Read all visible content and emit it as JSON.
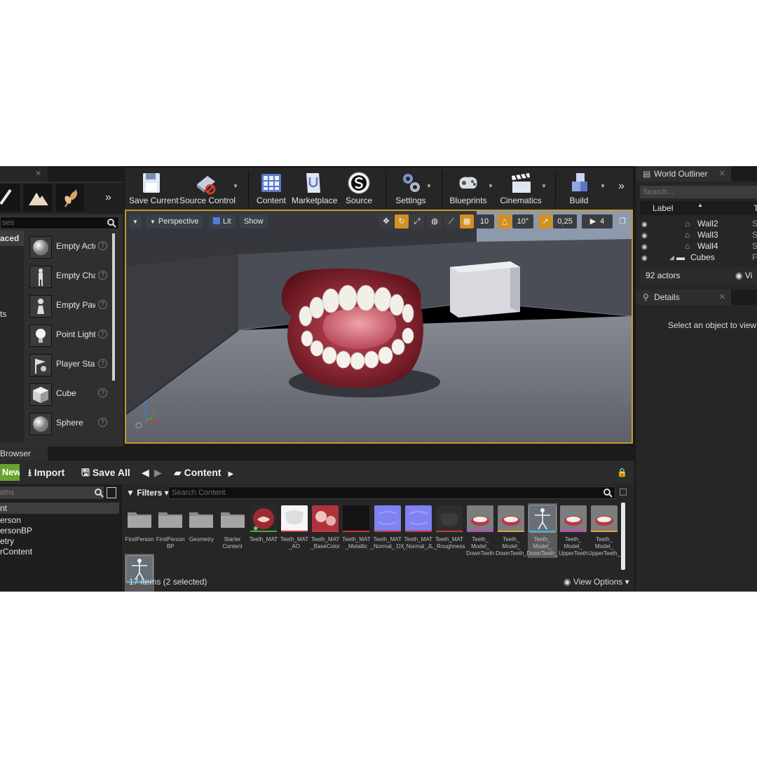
{
  "modes_panel": {
    "search_placeholder": "ses",
    "categories": [
      {
        "label": "aced",
        "selected": true
      },
      {
        "label": "ts",
        "selected": false
      }
    ],
    "place_items": [
      {
        "name": "Empty Actor",
        "icon": "sphere-icon"
      },
      {
        "name": "Empty Character",
        "icon": "mannequin-icon"
      },
      {
        "name": "Empty Pawn",
        "icon": "pawn-icon"
      },
      {
        "name": "Point Light",
        "icon": "lightbulb-icon"
      },
      {
        "name": "Player Start",
        "icon": "flag-icon"
      },
      {
        "name": "Cube",
        "icon": "cube-icon"
      },
      {
        "name": "Sphere",
        "icon": "sphere-icon"
      }
    ],
    "help_glyph": "?"
  },
  "toolbar": {
    "buttons": [
      {
        "label": "Save Current",
        "icon": "save-icon"
      },
      {
        "label": "Source Control",
        "icon": "source-control-icon"
      },
      {
        "label": "Content",
        "icon": "content-grid-icon"
      },
      {
        "label": "Marketplace",
        "icon": "marketplace-icon"
      },
      {
        "label": "Source",
        "icon": "source-icon"
      },
      {
        "label": "Settings",
        "icon": "settings-icon"
      },
      {
        "label": "Blueprints",
        "icon": "blueprints-icon"
      },
      {
        "label": "Cinematics",
        "icon": "clapper-icon"
      },
      {
        "label": "Build",
        "icon": "build-icon"
      }
    ]
  },
  "viewport": {
    "perspective_label": "Perspective",
    "lit_label": "Lit",
    "show_label": "Show",
    "grid_snap": "10",
    "rotation_snap": "10°",
    "scale_snap": "0,25",
    "camera_speed": "4",
    "accent_color": "#d28f24",
    "border_color": "#c49a2a"
  },
  "content_browser": {
    "tab_label": "Browser",
    "add_new_label": "Add New",
    "import_label": "Import",
    "save_all_label": "Save All",
    "path_label": "Content",
    "paths_placeholder": "Paths",
    "filters_label": "Filters",
    "search_placeholder": "Search Content",
    "folders": [
      {
        "label": "nt",
        "selected": true
      },
      {
        "label": "erson",
        "selected": false
      },
      {
        "label": "ersonBP",
        "selected": false
      },
      {
        "label": "etry",
        "selected": false
      },
      {
        "label": "rContent",
        "selected": false
      }
    ],
    "assets": [
      {
        "label": "FirstPerson",
        "kind": "folder"
      },
      {
        "label": "FirstPerson BP",
        "kind": "folder"
      },
      {
        "label": "Geometry",
        "kind": "folder"
      },
      {
        "label": "Starter Content",
        "kind": "folder"
      },
      {
        "label": "Teeth_MAT",
        "kind": "material"
      },
      {
        "label": "Teeth_MAT _AO",
        "kind": "texture-ao"
      },
      {
        "label": "Teeth_MAT _BaseColor",
        "kind": "texture-base"
      },
      {
        "label": "Teeth_MAT _Metallic",
        "kind": "texture-metal"
      },
      {
        "label": "Teeth_MAT _Normal_ DX",
        "kind": "texture-normal"
      },
      {
        "label": "Teeth_MAT _Normal_JL",
        "kind": "texture-normal"
      },
      {
        "label": "Teeth_MAT _Roughness",
        "kind": "texture-rough"
      },
      {
        "label": "Teeth_ Model_ DownTeeth",
        "kind": "mesh"
      },
      {
        "label": "Teeth_ Model_ DownTeeth_",
        "kind": "mesh-alt"
      },
      {
        "label": "Teeth_ Model_ DownTeeth_",
        "kind": "skeleton"
      },
      {
        "label": "Teeth_ Model_ UpperTeeth",
        "kind": "mesh"
      },
      {
        "label": "Teeth_ Model_ UpperTeeth_",
        "kind": "mesh-alt"
      },
      {
        "label": "",
        "kind": "skeleton"
      }
    ],
    "status": "17 items (2 selected)",
    "view_options_label": "View Options"
  },
  "world_outliner": {
    "tab_label": "World Outliner",
    "search_placeholder": "Search...",
    "label_header": "Label",
    "type_header": "T",
    "rows": [
      {
        "label": "Wall2",
        "type": "S",
        "icon": "static-mesh-icon"
      },
      {
        "label": "Wall3",
        "type": "S",
        "icon": "static-mesh-icon"
      },
      {
        "label": "Wall4",
        "type": "S",
        "icon": "static-mesh-icon"
      },
      {
        "label": "Cubes",
        "type": "F",
        "icon": "folder-icon"
      }
    ],
    "actor_count": "92 actors",
    "view_label": "Vi"
  },
  "details": {
    "tab_label": "Details",
    "empty_message": "Select an object to view de"
  }
}
